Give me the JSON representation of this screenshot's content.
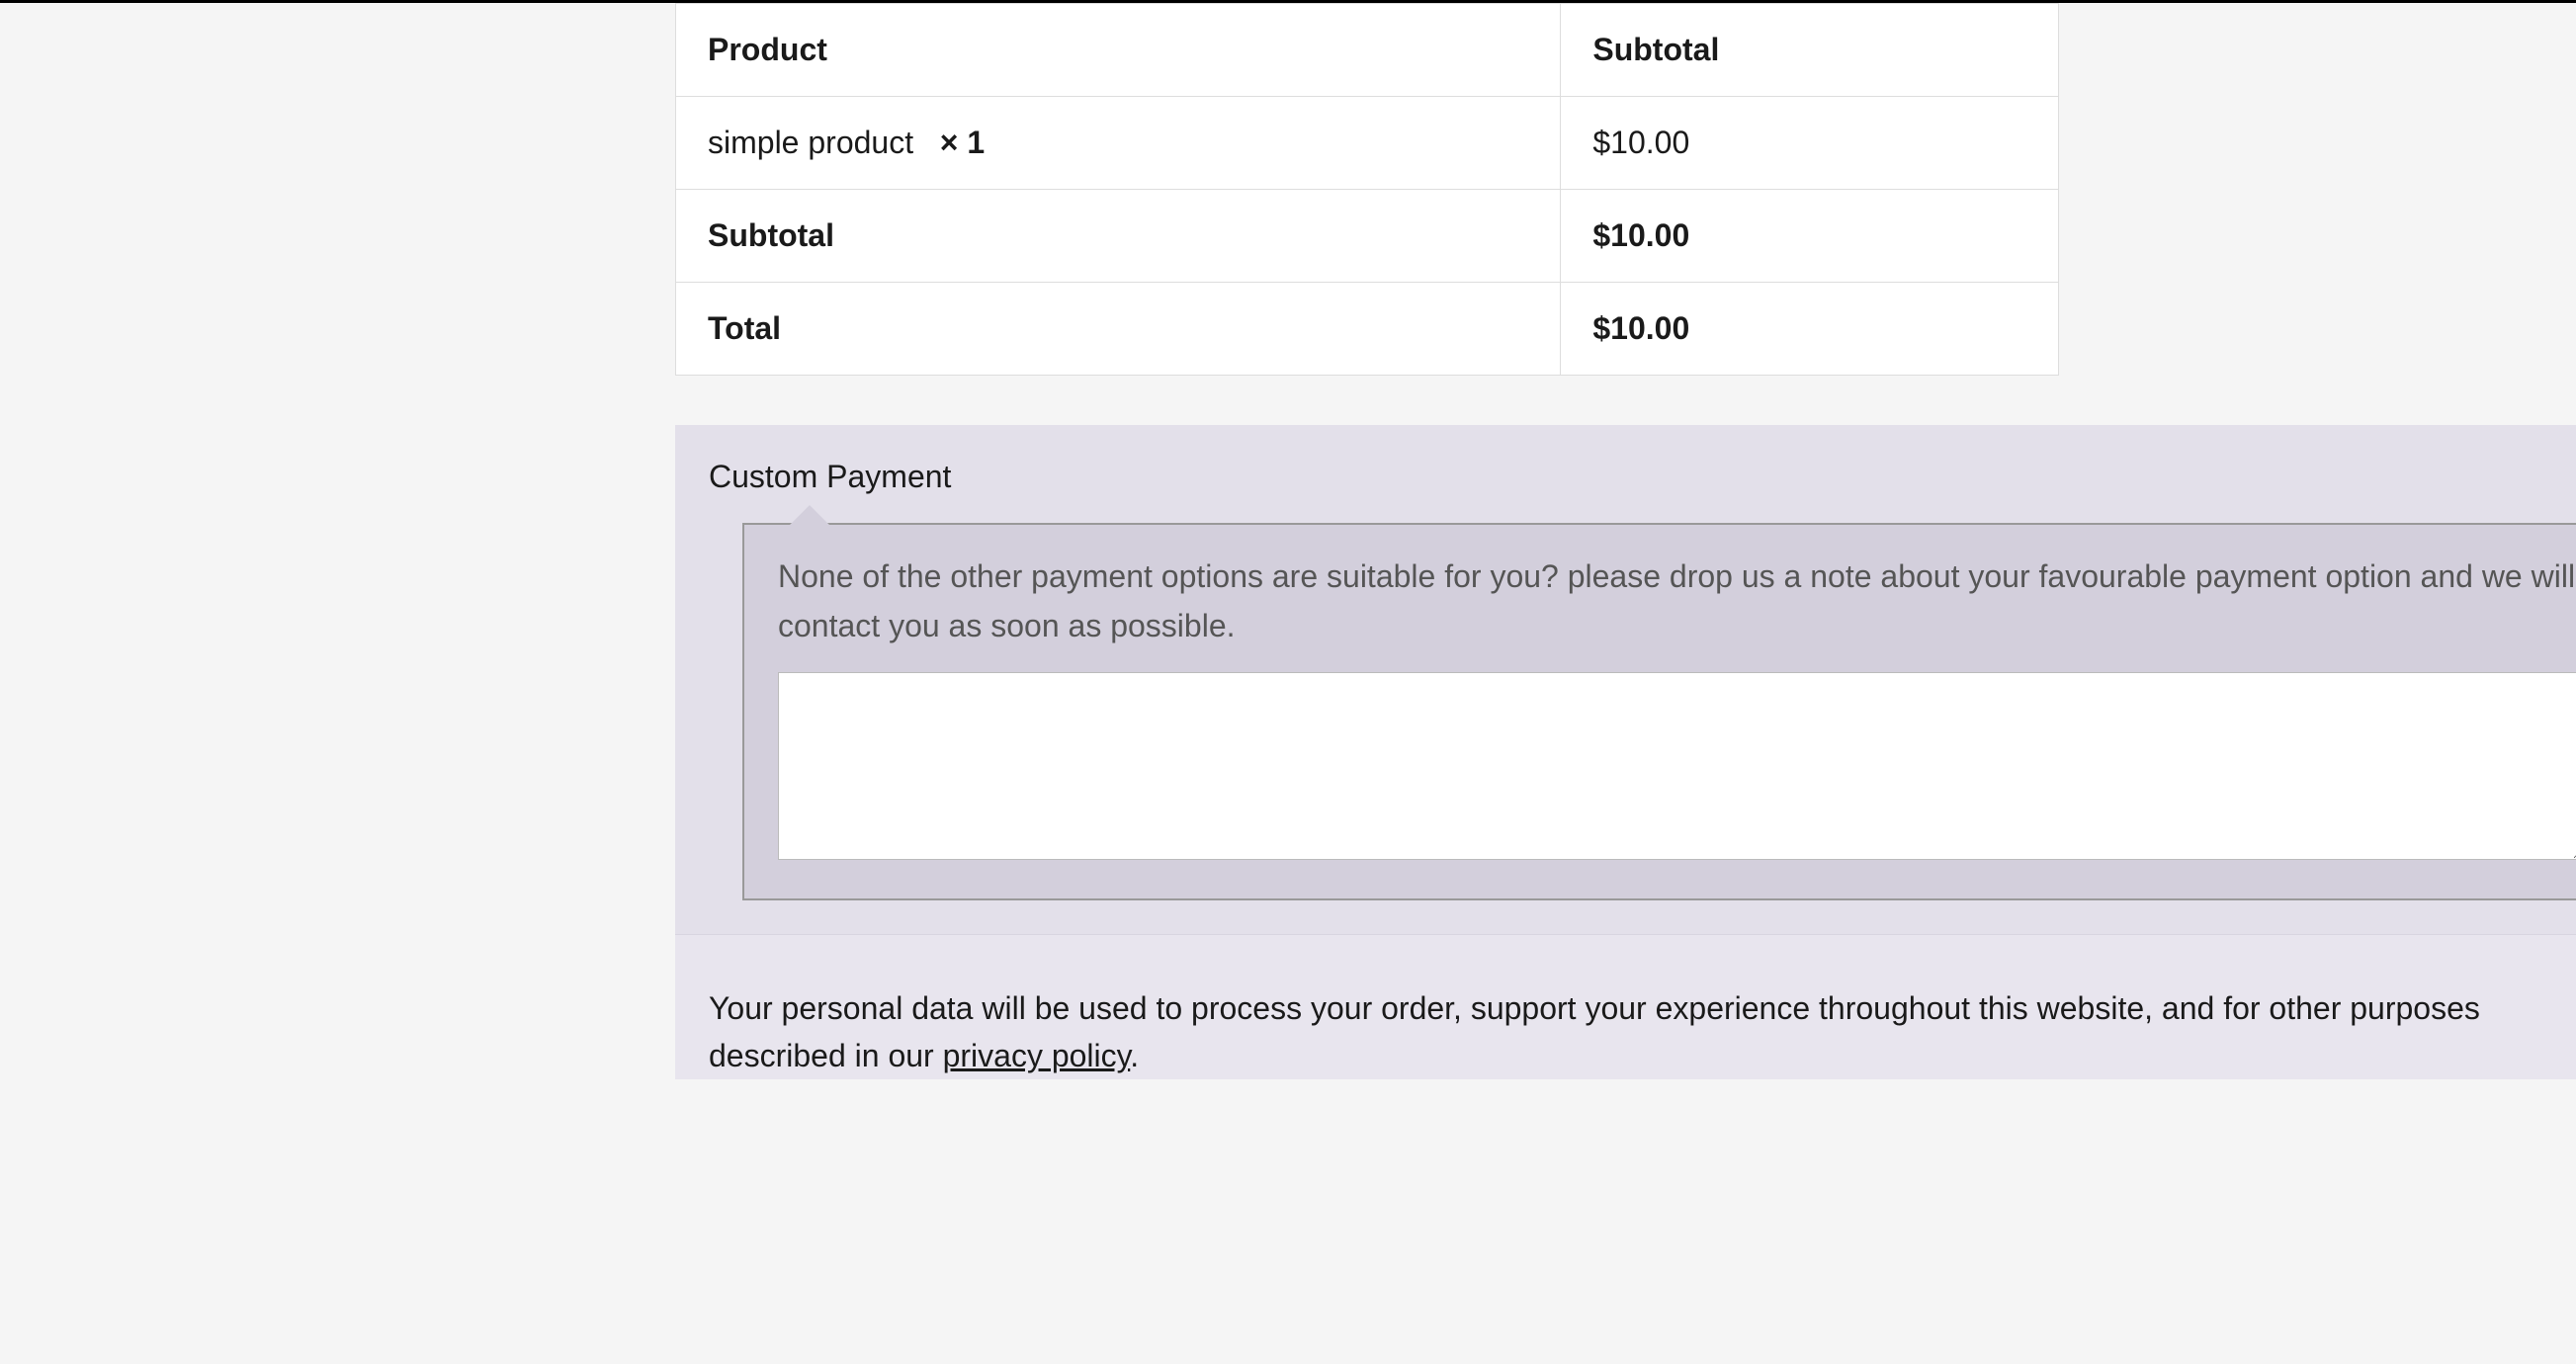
{
  "order": {
    "headers": {
      "product": "Product",
      "subtotal": "Subtotal"
    },
    "items": [
      {
        "name": "simple product",
        "qty": "× 1",
        "price": "$10.00"
      }
    ],
    "subtotal_label": "Subtotal",
    "subtotal_value": "$10.00",
    "total_label": "Total",
    "total_value": "$10.00"
  },
  "payment": {
    "title": "Custom Payment",
    "description": "None of the other payment options are suitable for you? please drop us a note about your favourable payment option and we will contact you as soon as possible.",
    "textarea_value": ""
  },
  "privacy": {
    "text_before": "Your personal data will be used to process your order, support your experience throughout this website, and for other purposes described in our ",
    "link_text": "privacy policy",
    "text_after": "."
  }
}
